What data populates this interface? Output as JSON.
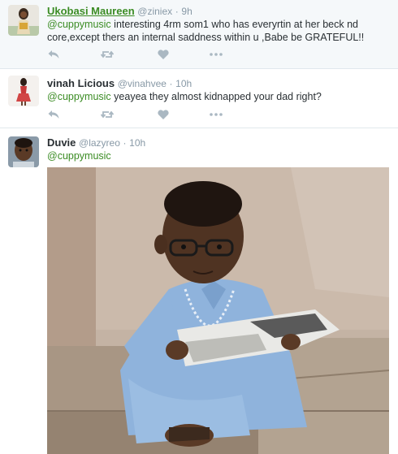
{
  "tweets": [
    {
      "name": "Ukobasi Maureen",
      "handle": "@ziniex",
      "separator": "·",
      "time": "9h",
      "mention": "@cuppymusic",
      "text": " interesting 4rm som1 who has everyrtin at her beck nd core,except thers an internal saddness within u ,Babe be GRATEFUL!!"
    },
    {
      "name": "vinah Licious",
      "handle": "@vinahvee",
      "separator": "·",
      "time": "10h",
      "mention": "@cuppymusic",
      "text": " yeayea they almost kidnapped your dad right?"
    },
    {
      "name": "Duvie",
      "handle": "@lazyreo",
      "separator": "·",
      "time": "10h",
      "mention": "@cuppymusic",
      "text": ""
    }
  ],
  "icons": {
    "reply": "reply-icon",
    "retweet": "retweet-icon",
    "like": "heart-icon",
    "more": "more-icon"
  },
  "colors": {
    "name_link": "#3b8c24",
    "mention": "#3b8c24",
    "meta": "#8899a6",
    "action": "#aab8c2",
    "highlight_bg": "#f5f8fa"
  }
}
